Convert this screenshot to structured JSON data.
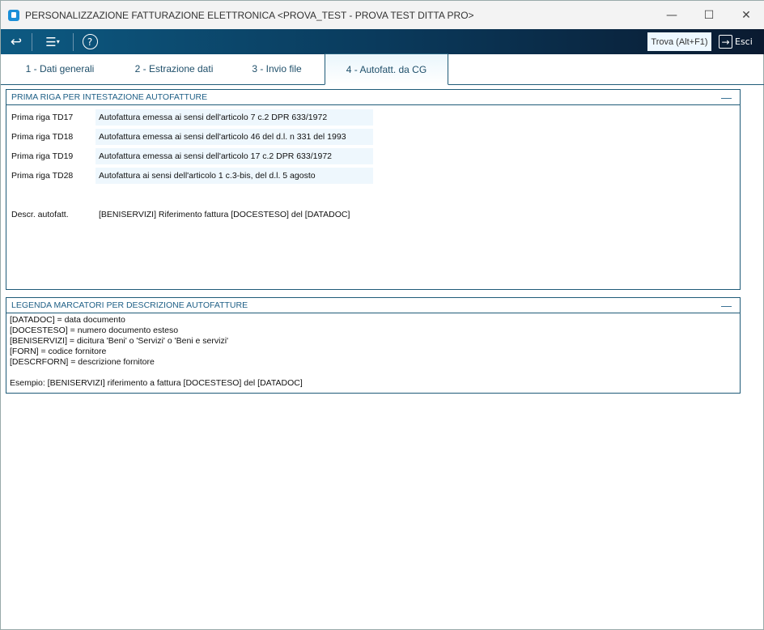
{
  "window": {
    "title": "PERSONALIZZAZIONE FATTURAZIONE ELETTRONICA <PROVA_TEST - PROVA TEST DITTA PRO>"
  },
  "toolbar": {
    "find_label": "Trova (Alt+F1)",
    "exit_label": "Esci"
  },
  "tabs": [
    {
      "label": "1 - Dati generali"
    },
    {
      "label": "2 - Estrazione dati"
    },
    {
      "label": "3 - Invio file"
    },
    {
      "label": "4 - Autofatt. da CG"
    }
  ],
  "panel1": {
    "title": "PRIMA RIGA PER INTESTAZIONE AUTOFATTURE",
    "rows": [
      {
        "label": "Prima riga TD17",
        "value": "Autofattura emessa ai sensi dell'articolo 7 c.2  DPR 633/1972"
      },
      {
        "label": "Prima riga TD18",
        "value": "Autofattura emessa ai sensi dell'articolo 46 del d.l. n 331 del 1993"
      },
      {
        "label": "Prima riga TD19",
        "value": "Autofattura emessa ai sensi dell'articolo 17 c.2  DPR 633/1972"
      },
      {
        "label": "Prima riga TD28",
        "value": "Autofattura ai sensi dell'articolo 1 c.3-bis, del d.l. 5 agosto"
      }
    ],
    "descr_label": "Descr. autofatt.",
    "descr_value": "[BENISERVIZI] Riferimento fattura [DOCESTESO] del [DATADOC]"
  },
  "panel2": {
    "title": "LEGENDA MARCATORI PER DESCRIZIONE AUTOFATTURE",
    "lines": [
      "[DATADOC] = data documento",
      "[DOCESTESO] = numero documento esteso",
      "[BENISERVIZI] = dicitura 'Beni' o 'Servizi' o 'Beni e servizi'",
      "[FORN] = codice fornitore",
      "[DESCRFORN] =  descrizione fornitore"
    ],
    "example": "Esempio: [BENISERVIZI] riferimento a fattura [DOCESTESO] del [DATADOC]"
  }
}
